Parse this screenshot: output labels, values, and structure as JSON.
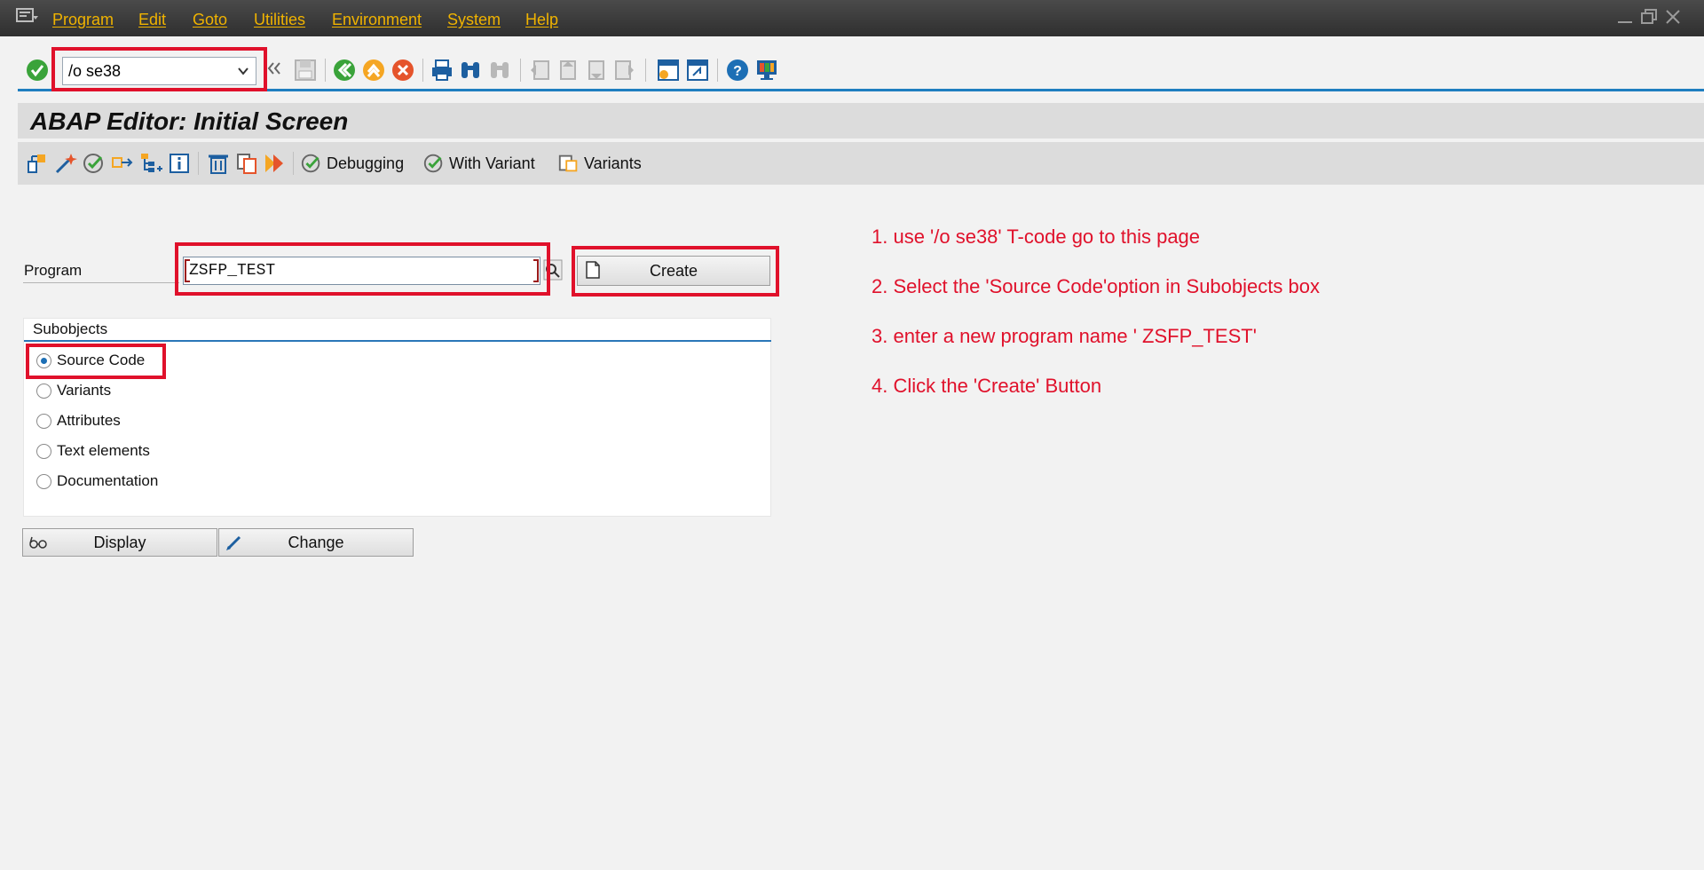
{
  "menu": {
    "items": [
      "Program",
      "Edit",
      "Goto",
      "Utilities",
      "Environment",
      "System",
      "Help"
    ]
  },
  "toolbar": {
    "command_value": "/o se38"
  },
  "title": "ABAP Editor: Initial Screen",
  "app_toolbar": {
    "debugging_label": "Debugging",
    "with_variant_label": "With Variant",
    "variants_label": "Variants"
  },
  "form": {
    "program_label": "Program",
    "program_value": "ZSFP_TEST",
    "create_label": "Create",
    "display_label": "Display",
    "change_label": "Change"
  },
  "subobjects": {
    "title": "Subobjects",
    "options": [
      {
        "label": "Source Code",
        "selected": true
      },
      {
        "label": "Variants",
        "selected": false
      },
      {
        "label": "Attributes",
        "selected": false
      },
      {
        "label": "Text elements",
        "selected": false
      },
      {
        "label": "Documentation",
        "selected": false
      }
    ]
  },
  "instructions": [
    "1. use '/o se38' T-code go to this page",
    "2. Select the 'Source Code'option in Subobjects box",
    "3. enter a new program name ' ZSFP_TEST'",
    "4. Click the 'Create' Button"
  ],
  "colors": {
    "accent": "#1f7ec0",
    "menu_text": "#f0b300",
    "annotation_red": "#e0112b"
  }
}
